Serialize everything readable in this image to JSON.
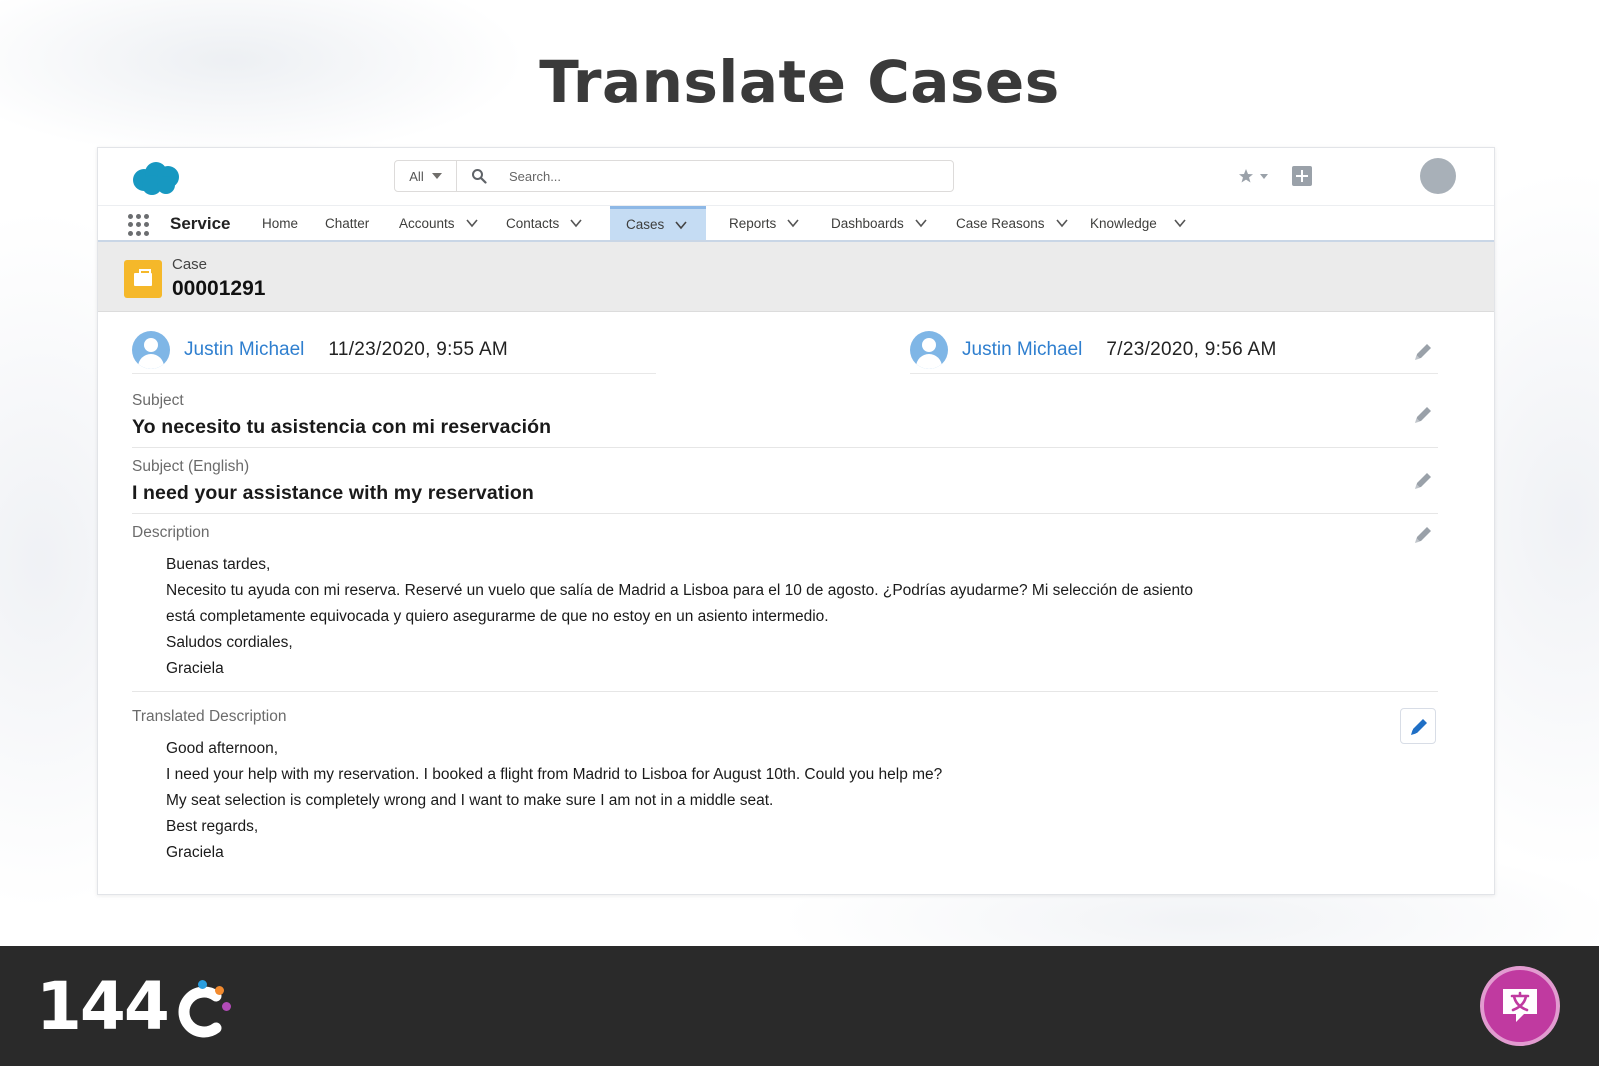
{
  "page": {
    "title": "Translate Cases"
  },
  "header": {
    "search_scope": "All",
    "search_placeholder": "Search..."
  },
  "nav": {
    "app_name": "Service",
    "items": [
      {
        "label": "Home",
        "has_menu": false
      },
      {
        "label": "Chatter",
        "has_menu": false
      },
      {
        "label": "Accounts",
        "has_menu": true
      },
      {
        "label": "Contacts",
        "has_menu": true
      },
      {
        "label": "Cases",
        "has_menu": true,
        "active": true
      },
      {
        "label": "Reports",
        "has_menu": true
      },
      {
        "label": "Dashboards",
        "has_menu": true
      },
      {
        "label": "Case Reasons",
        "has_menu": true
      },
      {
        "label": "Knowledge",
        "has_menu": true
      }
    ]
  },
  "record": {
    "object_label": "Case",
    "number": "00001291",
    "created_by": {
      "name": "Justin Michael",
      "date": "11/23/2020, 9:55 AM"
    },
    "modified_by": {
      "name": "Justin Michael",
      "date": "7/23/2020, 9:56 AM"
    },
    "subject": {
      "label": "Subject",
      "value": "Yo necesito tu asistencia con mi reservación"
    },
    "subject_en": {
      "label": "Subject (English)",
      "value": "I need your assistance with my reservation"
    },
    "description": {
      "label": "Description",
      "lines": [
        "Buenas tardes,",
        "Necesito tu ayuda con mi reserva. Reservé un vuelo que salía de Madrid a Lisboa para el 10 de agosto. ¿Podrías ayudarme? Mi selección de asiento",
        "está completamente equivocada y quiero asegurarme de que no estoy en un asiento intermedio.",
        "Saludos cordiales,",
        "Graciela"
      ]
    },
    "translated_description": {
      "label": "Translated Description",
      "lines": [
        "Good afternoon,",
        "I need your help with my reservation. I booked a flight from Madrid to Lisboa for August 10th. Could you help me?",
        "My seat selection is completely wrong and I want to make sure I am not in a middle seat.",
        "Best regards,",
        "Graciela"
      ]
    }
  },
  "footer": {
    "brand": "144"
  },
  "colors": {
    "brand_blue": "#1798c1",
    "link_blue": "#2f7fcf",
    "case_icon": "#f5b82a",
    "active_tab": "#c5dcf3",
    "footer_bg": "#2a2a2a",
    "badge": "#c03aa0"
  },
  "icons": {
    "logo": "salesforce-cloud-icon",
    "search": "search-icon",
    "favorite": "star-icon",
    "add": "plus-icon",
    "launcher": "app-launcher-icon",
    "edit": "pencil-icon",
    "case": "briefcase-icon",
    "chat": "translate-chat-icon"
  }
}
